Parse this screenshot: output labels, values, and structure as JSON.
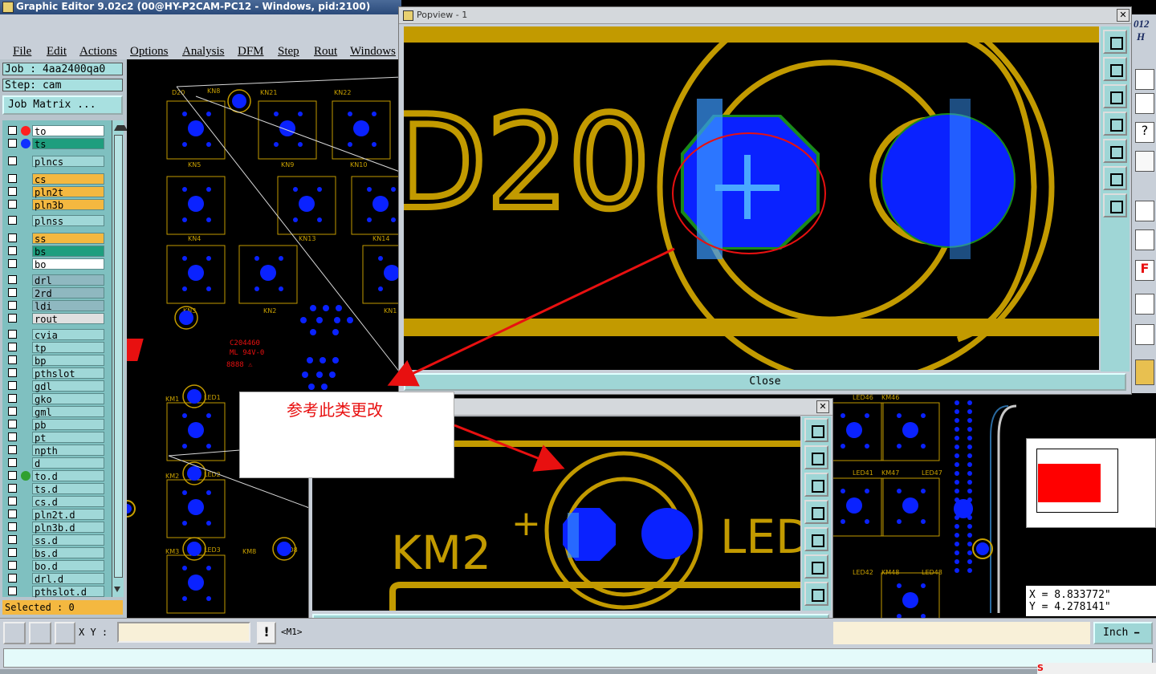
{
  "window": {
    "title": "Graphic Editor 9.02c2 (00@HY-P2CAM-PC12 - Windows, pid:2100)"
  },
  "menu": [
    "File",
    "Edit",
    "Actions",
    "Options",
    "Analysis",
    "DFM",
    "Step",
    "Rout",
    "Windows"
  ],
  "left_panel": {
    "job": "Job : 4aa2400qa0",
    "step": "Step: cam",
    "job_matrix_button": "Job Matrix ...",
    "selected": "Selected : 0",
    "layers": [
      {
        "name": "to",
        "color": "#ffffff"
      },
      {
        "name": "ts",
        "color": "#1e9e7e"
      },
      {
        "name": "plncs",
        "color": "#a0d8d8"
      },
      {
        "name": "cs",
        "color": "#f4b840"
      },
      {
        "name": "pln2t",
        "color": "#f4b840"
      },
      {
        "name": "pln3b",
        "color": "#f4b840"
      },
      {
        "name": "plnss",
        "color": "#a0d8d8"
      },
      {
        "name": "ss",
        "color": "#f4b840"
      },
      {
        "name": "bs",
        "color": "#1e9e7e"
      },
      {
        "name": "bo",
        "color": "#ffffff"
      },
      {
        "name": "drl",
        "color": "#8fb8c0"
      },
      {
        "name": "2rd",
        "color": "#8fb8c0"
      },
      {
        "name": "ldi",
        "color": "#8fb8c0"
      },
      {
        "name": "rout",
        "color": "#e0e0e0"
      },
      {
        "name": "cvia",
        "color": "#a0d8d8"
      },
      {
        "name": "tp",
        "color": "#a0d8d8"
      },
      {
        "name": "bp",
        "color": "#a0d8d8"
      },
      {
        "name": "pthslot",
        "color": "#a0d8d8"
      },
      {
        "name": "gdl",
        "color": "#a0d8d8"
      },
      {
        "name": "gko",
        "color": "#a0d8d8"
      },
      {
        "name": "gml",
        "color": "#a0d8d8"
      },
      {
        "name": "pb",
        "color": "#a0d8d8"
      },
      {
        "name": "pt",
        "color": "#a0d8d8"
      },
      {
        "name": "npth",
        "color": "#a0d8d8"
      },
      {
        "name": "d",
        "color": "#a0d8d8"
      },
      {
        "name": "to.d",
        "color": "#a0d8d8"
      },
      {
        "name": "ts.d",
        "color": "#a0d8d8"
      },
      {
        "name": "cs.d",
        "color": "#a0d8d8"
      },
      {
        "name": "pln2t.d",
        "color": "#a0d8d8"
      },
      {
        "name": "pln3b.d",
        "color": "#a0d8d8"
      },
      {
        "name": "ss.d",
        "color": "#a0d8d8"
      },
      {
        "name": "bs.d",
        "color": "#a0d8d8"
      },
      {
        "name": "bo.d",
        "color": "#a0d8d8"
      },
      {
        "name": "drl.d",
        "color": "#a0d8d8"
      },
      {
        "name": "pthslot.d",
        "color": "#a0d8d8"
      }
    ]
  },
  "canvas": {
    "components": [
      "D20",
      "KN8",
      "KN21",
      "KN22",
      "KN5",
      "KN9",
      "KN10",
      "KN4",
      "KN13",
      "KN14",
      "KN3",
      "KN2",
      "KN1",
      "KM1",
      "LED1",
      "KM2",
      "LED2",
      "KM3",
      "LED3",
      "KM8",
      "LED8",
      "LED41",
      "LED42",
      "LED46",
      "LED47",
      "LED48",
      "KM46",
      "KM47",
      "KM48"
    ],
    "marking_lines": [
      "C204460",
      "ML 94V-0"
    ]
  },
  "popview": {
    "title": "Popview - 1",
    "label": "D20",
    "close": "Close"
  },
  "popview2": {
    "label_left": "KM2",
    "label_plus": "+",
    "label_right": "LED",
    "close": "Close"
  },
  "annotation": {
    "text": "参考此类更改"
  },
  "status": {
    "xy_label": "X Y :",
    "m_label": "<M1>",
    "x_readout": "X = 8.833772\"",
    "y_readout": "Y = 4.278141\"",
    "unit": "Inch"
  },
  "colors": {
    "pad": "#0a22ff",
    "silk": "#c29a00",
    "copper": "#c8a000",
    "annotation_red": "#e81010"
  }
}
